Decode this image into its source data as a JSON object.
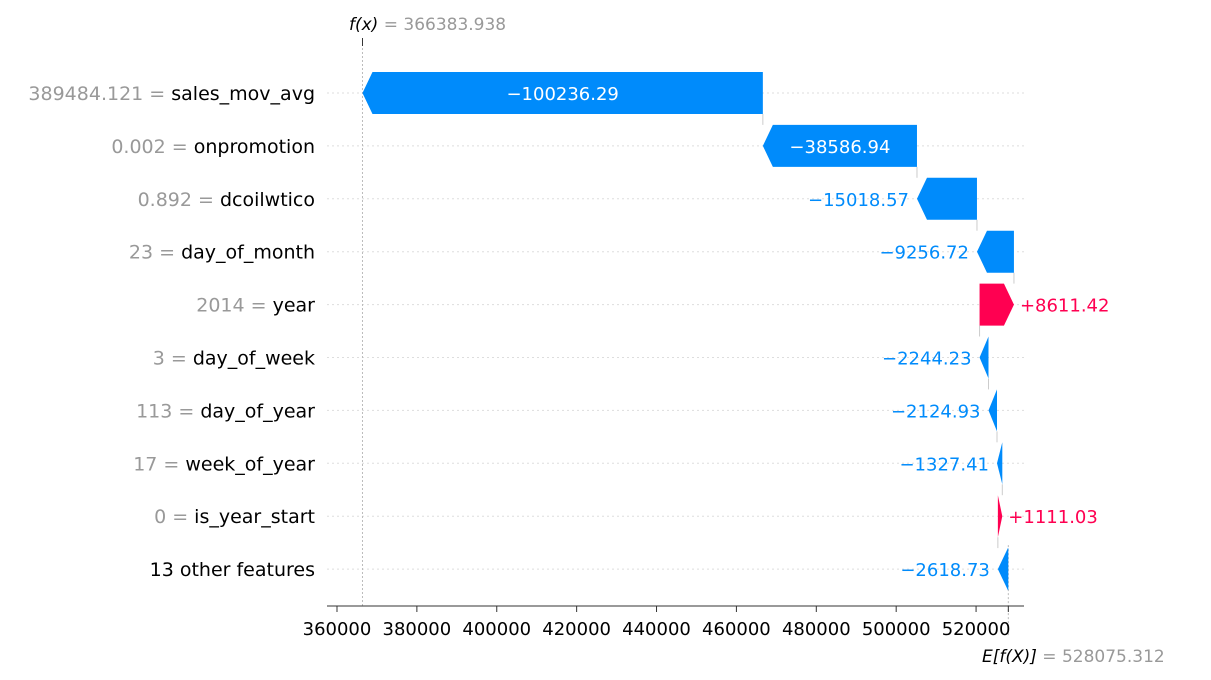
{
  "colors": {
    "negative": "#008bfb",
    "positive": "#ff0051",
    "grid": "#dddddd",
    "axis": "#333333"
  },
  "chart_data": {
    "type": "waterfall",
    "fx_label": "f(x)",
    "fx_value": "366383.938",
    "ex_label": "E[f(X)]",
    "ex_value": "528075.312",
    "fx": 366383.938,
    "ex": 528075.312,
    "xlim": [
      357500,
      532000
    ],
    "xticks": [
      360000,
      380000,
      400000,
      420000,
      440000,
      460000,
      480000,
      500000,
      520000
    ],
    "xtick_labels": [
      "360000",
      "380000",
      "400000",
      "420000",
      "440000",
      "460000",
      "480000",
      "500000",
      "520000"
    ],
    "features": [
      {
        "value": "389484.121",
        "name": "sales_mov_avg",
        "shap": -100236.29,
        "label": "−100236.29"
      },
      {
        "value": "0.002",
        "name": "onpromotion",
        "shap": -38586.94,
        "label": "−38586.94"
      },
      {
        "value": "0.892",
        "name": "dcoilwtico",
        "shap": -15018.57,
        "label": "−15018.57"
      },
      {
        "value": "23",
        "name": "day_of_month",
        "shap": -9256.72,
        "label": "−9256.72"
      },
      {
        "value": "2014",
        "name": "year",
        "shap": 8611.42,
        "label": "+8611.42"
      },
      {
        "value": "3",
        "name": "day_of_week",
        "shap": -2244.23,
        "label": "−2244.23"
      },
      {
        "value": "113",
        "name": "day_of_year",
        "shap": -2124.93,
        "label": "−2124.93"
      },
      {
        "value": "17",
        "name": "week_of_year",
        "shap": -1327.41,
        "label": "−1327.41"
      },
      {
        "value": "0",
        "name": "is_year_start",
        "shap": 1111.03,
        "label": "+1111.03"
      },
      {
        "value": "",
        "name": "13 other features",
        "shap": -2618.73,
        "label": "−2618.73"
      }
    ]
  }
}
